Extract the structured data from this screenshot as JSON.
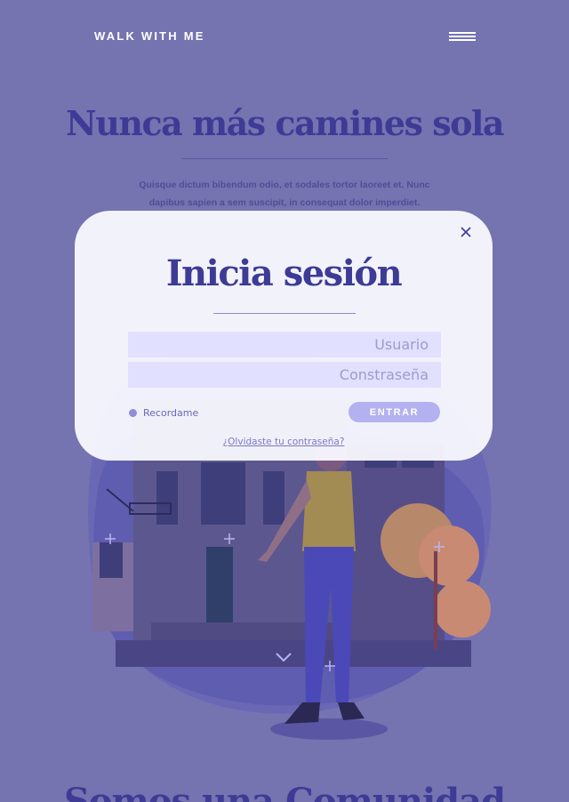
{
  "header": {
    "brand": "WALK WITH ME",
    "menu_icon": "hamburger-menu-icon"
  },
  "hero": {
    "title": "Nunca más camines sola",
    "subtitle": "Quisque dictum bibendum odio, et sodales tortor laoreet et. Nunc dapibus sapien a sem suscipit, in consequat dolor imperdiet.",
    "scroll_icon": "chevron-down-icon"
  },
  "login_modal": {
    "title": "Inicia sesión",
    "username_placeholder": "Usuario",
    "password_placeholder": "Constraseña",
    "remember_label": "Recordame",
    "submit_label": "ENTRAR",
    "forgot_label": "¿Olvidaste tu contraseña?",
    "close_icon": "close-icon"
  },
  "next_section": {
    "title": "Somos una Comunidad"
  },
  "colors": {
    "background": "#7573b0",
    "primary_text": "#3d3b95",
    "input_bg": "#e1e0ff",
    "button_bg": "#b3b1f0",
    "modal_bg": "#fafaff"
  }
}
